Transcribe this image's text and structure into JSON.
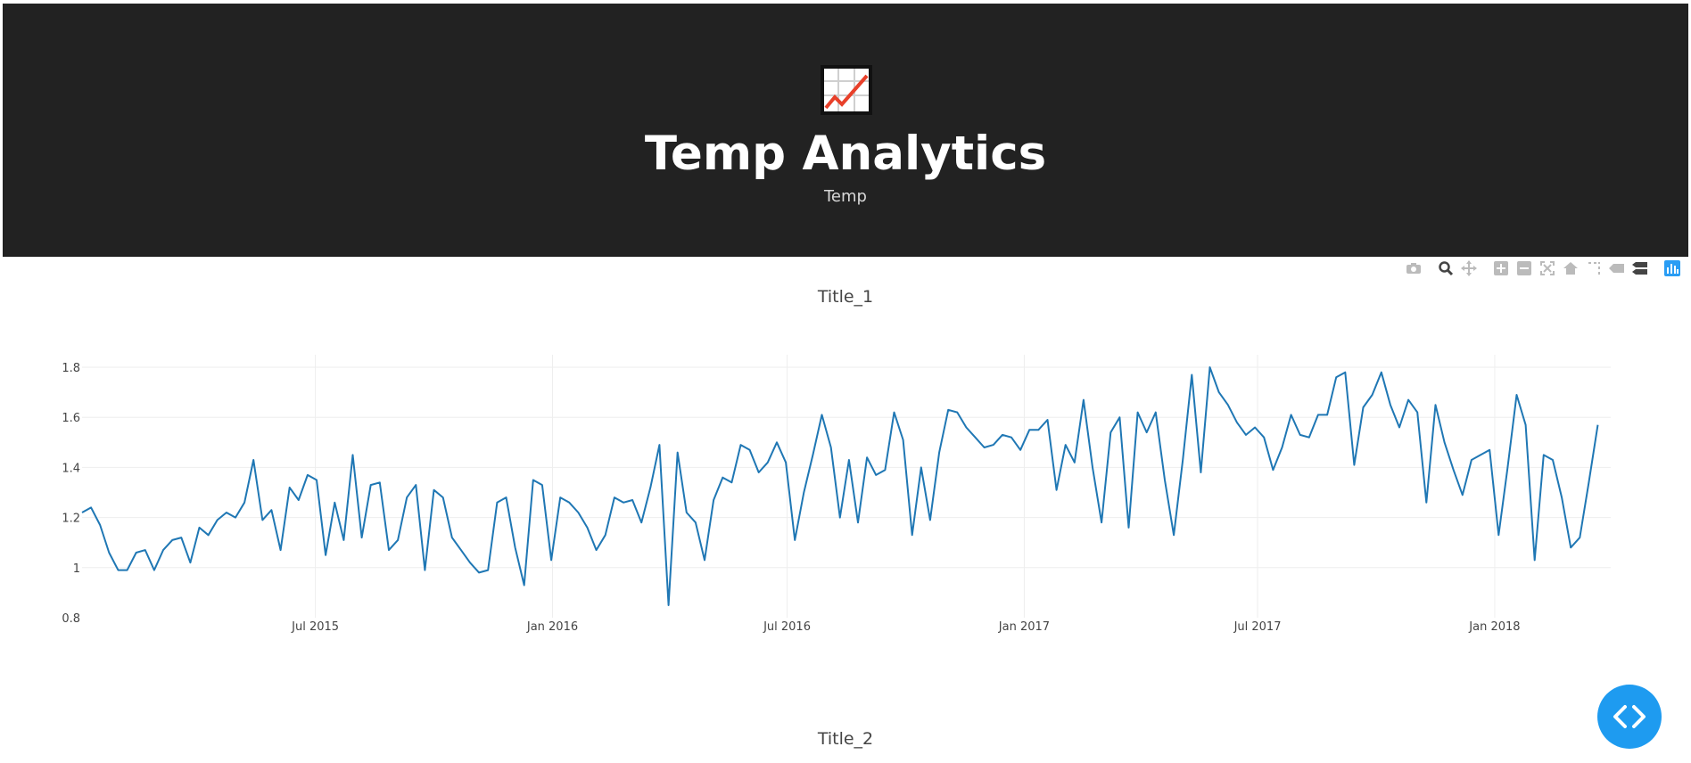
{
  "header": {
    "logo_icon": "chart-increasing-icon",
    "title": "Temp Analytics",
    "subtitle": "Temp",
    "background": "#222222"
  },
  "modebar": {
    "icons": [
      "camera-icon",
      "zoom-icon",
      "pan-icon",
      "zoom-in-icon",
      "zoom-out-icon",
      "autoscale-icon",
      "reset-axes-icon",
      "spike-lines-icon",
      "hover-closest-icon",
      "hover-compare-icon",
      "plotly-logo-icon"
    ]
  },
  "charts": [
    {
      "title": "Title_1"
    },
    {
      "title": "Title_2"
    }
  ],
  "chart_data": {
    "type": "line",
    "title": "Title_1",
    "xlabel": "",
    "ylabel": "",
    "line_color": "#1f77b4",
    "grid": true,
    "xlim": [
      "2015-01-01",
      "2018-04-01"
    ],
    "ylim": [
      0.8,
      1.85
    ],
    "x_ticks": [
      "Jul 2015",
      "Jan 2016",
      "Jul 2016",
      "Jan 2017",
      "Jul 2017",
      "Jan 2018"
    ],
    "x_tick_dates": [
      "2015-07-01",
      "2016-01-01",
      "2016-07-01",
      "2017-01-01",
      "2017-07-01",
      "2018-01-01"
    ],
    "y_ticks": [
      0.8,
      1,
      1.2,
      1.4,
      1.6,
      1.8
    ],
    "y_tick_labels": [
      "0.8",
      "1",
      "1.2",
      "1.4",
      "1.6",
      "1.8"
    ],
    "series": [
      {
        "x_start": "2015-01-01",
        "x_step_days": 7,
        "values": [
          1.22,
          1.24,
          1.17,
          1.06,
          0.99,
          0.99,
          1.06,
          1.07,
          0.99,
          1.07,
          1.11,
          1.12,
          1.02,
          1.16,
          1.13,
          1.19,
          1.22,
          1.2,
          1.26,
          1.43,
          1.19,
          1.23,
          1.07,
          1.32,
          1.27,
          1.37,
          1.35,
          1.05,
          1.26,
          1.11,
          1.45,
          1.12,
          1.33,
          1.34,
          1.07,
          1.11,
          1.28,
          1.33,
          0.99,
          1.31,
          1.28,
          1.12,
          1.07,
          1.02,
          0.98,
          0.99,
          1.26,
          1.28,
          1.08,
          0.93,
          1.35,
          1.33,
          1.03,
          1.28,
          1.26,
          1.22,
          1.16,
          1.07,
          1.13,
          1.28,
          1.26,
          1.27,
          1.18,
          1.32,
          1.49,
          0.85,
          1.46,
          1.22,
          1.18,
          1.03,
          1.27,
          1.36,
          1.34,
          1.49,
          1.47,
          1.38,
          1.42,
          1.5,
          1.42,
          1.11,
          1.3,
          1.45,
          1.61,
          1.48,
          1.2,
          1.43,
          1.18,
          1.44,
          1.37,
          1.39,
          1.62,
          1.51,
          1.13,
          1.4,
          1.19,
          1.46,
          1.63,
          1.62,
          1.56,
          1.52,
          1.48,
          1.49,
          1.53,
          1.52,
          1.47,
          1.55,
          1.55,
          1.59,
          1.31,
          1.49,
          1.42,
          1.67,
          1.4,
          1.18,
          1.54,
          1.6,
          1.16,
          1.62,
          1.54,
          1.62,
          1.35,
          1.13,
          1.43,
          1.77,
          1.38,
          1.8,
          1.7,
          1.65,
          1.58,
          1.53,
          1.56,
          1.52,
          1.39,
          1.48,
          1.61,
          1.53,
          1.52,
          1.61,
          1.61,
          1.76,
          1.78,
          1.41,
          1.64,
          1.69,
          1.78,
          1.65,
          1.56,
          1.67,
          1.62,
          1.26,
          1.65,
          1.5,
          1.39,
          1.29,
          1.43,
          1.45,
          1.47,
          1.13,
          1.4,
          1.69,
          1.57,
          1.03,
          1.45,
          1.43,
          1.28,
          1.08,
          1.12,
          1.34,
          1.57
        ]
      }
    ]
  }
}
